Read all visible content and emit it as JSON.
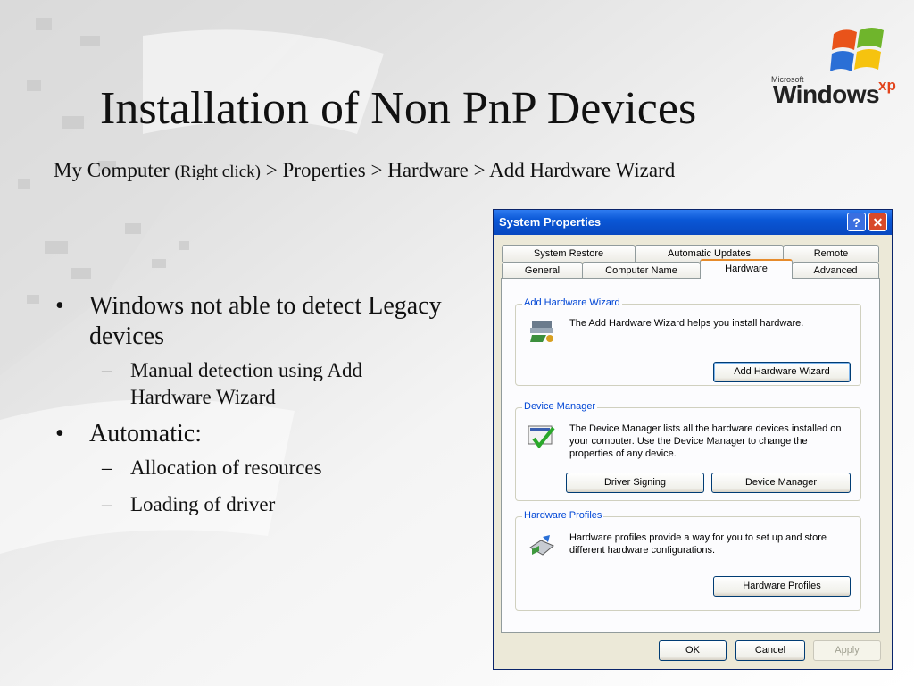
{
  "slide": {
    "title": "Installation of Non PnP Devices",
    "path_part1": "My Computer",
    "path_part2": "(Right click)",
    "path_part3": "> Properties > Hardware > Add Hardware Wizard",
    "bullets": [
      {
        "text": "Windows not able to detect Legacy devices",
        "sub": [
          "Manual detection using Add Hardware Wizard"
        ]
      },
      {
        "text": "Automatic:",
        "sub": [
          "Allocation of resources",
          "Loading of driver"
        ]
      }
    ]
  },
  "logo": {
    "microsoft": "Microsoft",
    "windows": "Windows",
    "xp": "xp"
  },
  "dialog": {
    "title": "System Properties",
    "help_label": "?",
    "close_label": "✕",
    "tabs_row1": [
      "System Restore",
      "Automatic Updates",
      "Remote"
    ],
    "tabs_row2": [
      "General",
      "Computer Name",
      "Hardware",
      "Advanced"
    ],
    "active_tab": "Hardware",
    "groups": {
      "add_hw": {
        "legend": "Add Hardware Wizard",
        "desc": "The Add Hardware Wizard helps you install hardware.",
        "button": "Add Hardware Wizard"
      },
      "device_mgr": {
        "legend": "Device Manager",
        "desc": "The Device Manager lists all the hardware devices installed on your computer. Use the Device Manager to change the properties of any device.",
        "button_signing": "Driver Signing",
        "button_manager": "Device Manager"
      },
      "profiles": {
        "legend": "Hardware Profiles",
        "desc": "Hardware profiles provide a way for you to set up and store different hardware configurations.",
        "button": "Hardware Profiles"
      }
    },
    "footer": {
      "ok": "OK",
      "cancel": "Cancel",
      "apply": "Apply"
    }
  },
  "colors": {
    "titlebar": "#0a57d6",
    "legend_text": "#0046d5",
    "tab_accent": "#e68b2c",
    "close": "#d8492a"
  }
}
